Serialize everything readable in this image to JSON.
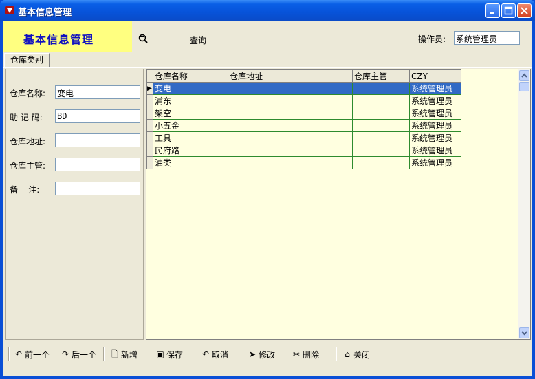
{
  "window": {
    "title": "基本信息管理"
  },
  "header": {
    "banner": "基本信息管理",
    "query_label": "查询",
    "operator_label": "操作员:",
    "operator_value": "系统管理员"
  },
  "tabs": [
    {
      "label": "仓库类别"
    }
  ],
  "form": {
    "name_label": "仓库名称:",
    "name_value": "变电",
    "mnemonic_label": "助 记 码:",
    "mnemonic_value": "BD",
    "address_label": "仓库地址:",
    "address_value": "",
    "manager_label": "仓库主管:",
    "manager_value": "",
    "note_label": "备    注:",
    "note_value": ""
  },
  "grid": {
    "columns": [
      "仓库名称",
      "仓库地址",
      "仓库主管",
      "CZY"
    ],
    "rows": [
      [
        "变电",
        "",
        "",
        "系统管理员"
      ],
      [
        "浦东",
        "",
        "",
        "系统管理员"
      ],
      [
        "架空",
        "",
        "",
        "系统管理员"
      ],
      [
        "小五金",
        "",
        "",
        "系统管理员"
      ],
      [
        "工具",
        "",
        "",
        "系统管理员"
      ],
      [
        "民府路",
        "",
        "",
        "系统管理员"
      ],
      [
        "油类",
        "",
        "",
        "系统管理员"
      ]
    ],
    "selected_row": 0
  },
  "toolbar": {
    "prev": "前一个",
    "next": "后一个",
    "new": "新增",
    "save": "保存",
    "cancel": "取消",
    "edit": "修改",
    "delete": "删除",
    "close": "关闭"
  },
  "colors": {
    "title_bar": "#0a4fd6",
    "banner_bg": "#ffff80",
    "banner_text": "#1010c0",
    "grid_bg": "#ffffe0",
    "selection": "#316ac5"
  }
}
